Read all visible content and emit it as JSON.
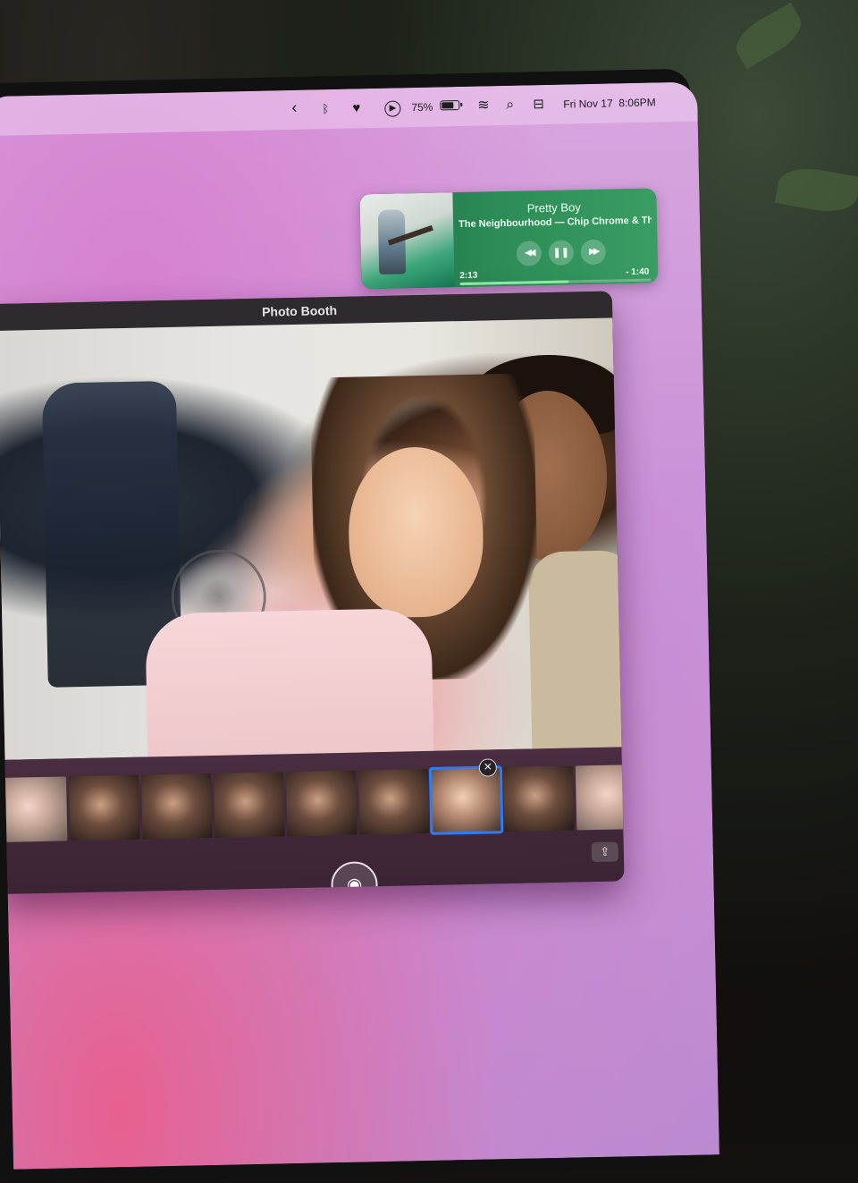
{
  "menubar": {
    "items": [
      {
        "icon": "chevron-left-icon",
        "glyph": "‹"
      },
      {
        "icon": "bluetooth-icon",
        "glyph": "ᛒ"
      },
      {
        "icon": "heart-icon",
        "glyph": "♥"
      },
      {
        "icon": "play-circle-icon",
        "glyph": "▶"
      }
    ],
    "battery_percent": "75%",
    "battery_level": 0.75,
    "wifi_glyph": "≋",
    "search_glyph": "⌕",
    "control_center_glyph": "⊟",
    "datetime": "Fri Nov 17  8:06PM"
  },
  "now_playing": {
    "title": "Pretty Boy",
    "artist": "The Neighbourhood — Chip Chrome & Th...",
    "elapsed": "2:13",
    "remaining": "- 1:40",
    "progress": 0.57,
    "controls": {
      "rewind": "◀◀",
      "pause": "❚❚",
      "forward": "▶▶"
    },
    "accent_color": "#2c8b57"
  },
  "photo_booth": {
    "title": "Photo Booth",
    "delete_glyph": "✕",
    "share_glyph": "⇪",
    "shutter_glyph": "◉",
    "thumbnail_count": 9,
    "selected_index": 6,
    "selection_color": "#2f7bf5"
  }
}
